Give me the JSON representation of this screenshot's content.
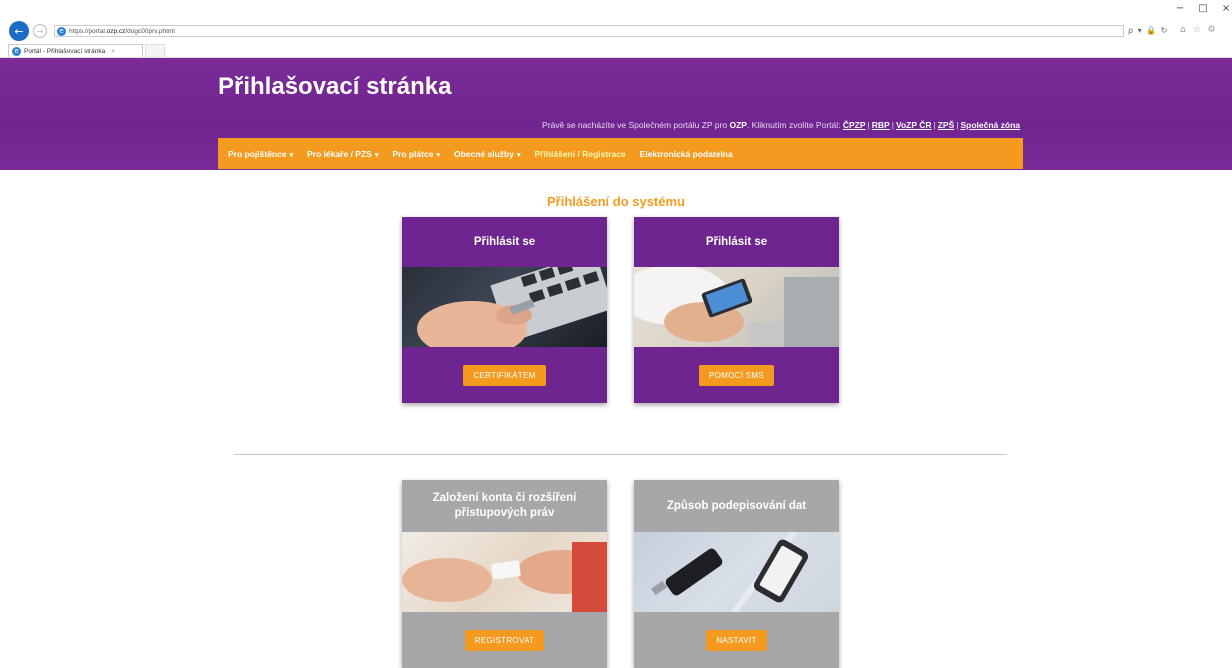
{
  "browser": {
    "url_prefix": "https://portal.",
    "url_domain": "ozp.cz",
    "url_path": "/dogc00prv.phtml",
    "tab_title": "Portál - Přihlašovací stránka",
    "tab_close": "×",
    "back_glyph": "←",
    "fwd_glyph": "→",
    "tools": "ρ ▾ 🔒 ↻",
    "right_icons": "⌂ ☆ ⚙",
    "win_min": "−",
    "win_max": "□",
    "win_close": "×"
  },
  "header": {
    "title": "Přihlašovací stránka",
    "info_prefix": "Právě se nacházíte ve Společném portálu ZP pro",
    "info_org": "OZP",
    "info_middle": ". Kliknutím zvolíte Portál:",
    "portals": [
      "ČPZP",
      "RBP",
      "VoZP ČR",
      "ZPŠ",
      "Společná zóna"
    ],
    "portal_sep": "|"
  },
  "menu": {
    "items": [
      {
        "label": "Pro pojištěnce",
        "caret": "▾"
      },
      {
        "label": "Pro lékaře / PZS",
        "caret": "▾"
      },
      {
        "label": "Pro plátce",
        "caret": "▾"
      },
      {
        "label": "Obecné služby",
        "caret": "▾"
      },
      {
        "label": "Přihlášení / Registrace",
        "caret": ""
      },
      {
        "label": "Elektronická podatelna",
        "caret": ""
      }
    ]
  },
  "main": {
    "section_title": "Přihlášení do systému",
    "cards": [
      {
        "title": "Přihlásit se",
        "button": "CERTIFIKÁTEM"
      },
      {
        "title": "Přihlásit se",
        "button": "POMOCÍ SMS"
      },
      {
        "title": "Založení konta či rozšíření přístupových práv",
        "button": "REGISTROVAT"
      },
      {
        "title": "Způsob podepisování dat",
        "button": "NASTAVIT"
      }
    ]
  },
  "colors": {
    "purple": "#6f2590",
    "orange": "#f39a1f",
    "gray": "#a7a7a9"
  }
}
